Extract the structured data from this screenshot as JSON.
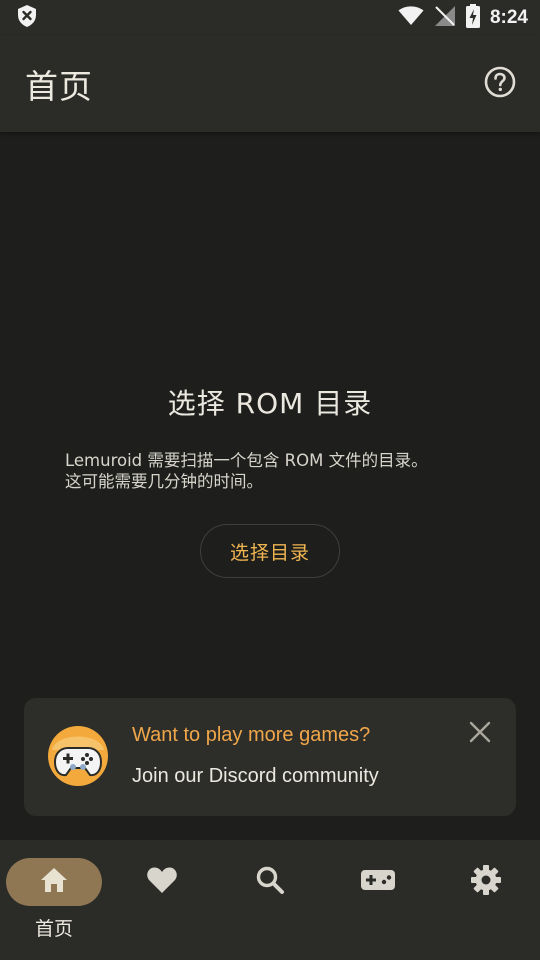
{
  "status_bar": {
    "time": "8:24"
  },
  "app_bar": {
    "title": "首页",
    "help_icon": "help-circle-icon"
  },
  "empty_state": {
    "title": "选择 ROM 目录",
    "description": "Lemuroid 需要扫描一个包含 ROM 文件的目录。\n这可能需要几分钟的时间。",
    "button_label": "选择目录"
  },
  "discord_card": {
    "headline": "Want to play more games?",
    "subline": "Join our Discord community",
    "avatar_icon": "gamepad-mascot-icon",
    "close_icon": "close-icon"
  },
  "bottom_nav": {
    "items": [
      {
        "icon": "home-icon",
        "label": "首页",
        "active": true
      },
      {
        "icon": "heart-icon",
        "label": "",
        "active": false
      },
      {
        "icon": "search-icon",
        "label": "",
        "active": false
      },
      {
        "icon": "gamepad-icon",
        "label": "",
        "active": false
      },
      {
        "icon": "gear-icon",
        "label": "",
        "active": false
      }
    ]
  },
  "colors": {
    "background": "#1e1f1c",
    "surface": "#2b2c28",
    "accent": "#f0b451",
    "active_pill": "#8f7754"
  }
}
